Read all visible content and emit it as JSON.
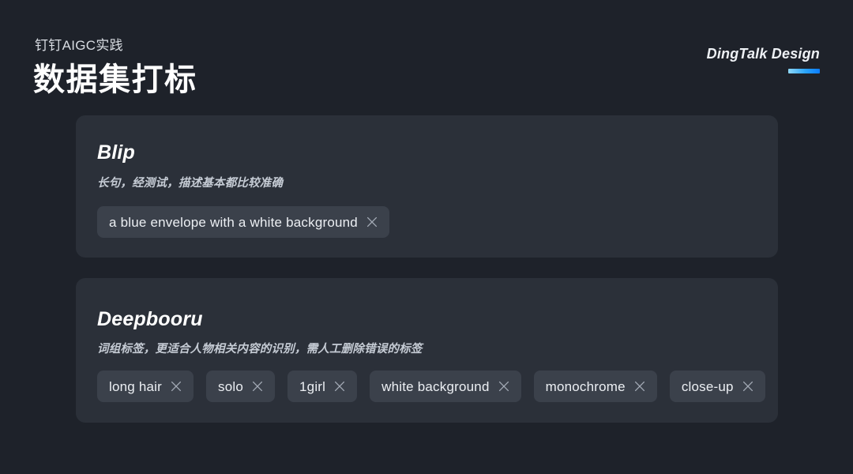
{
  "header": {
    "eyebrow": "钉钉AIGC实践",
    "title": "数据集打标",
    "brand": "DingTalk Design",
    "accent_gradient_from": "#8fd8f7",
    "accent_gradient_to": "#0a7cff"
  },
  "theme": {
    "page_background": "#1e222a",
    "card_background": "#2b3039",
    "chip_background": "#3b414b",
    "text_primary": "#ffffff",
    "text_secondary": "#c6ccd5",
    "chip_text": "#eceff3",
    "chip_close_icon": "#a4abb6"
  },
  "cards": [
    {
      "id": "blip",
      "title": "Blip",
      "subtitle": "长句，经测试，描述基本都比较准确",
      "tags": [
        {
          "label": "a blue envelope with a white background",
          "close_icon": "close-icon"
        }
      ]
    },
    {
      "id": "deepbooru",
      "title": "Deepbooru",
      "subtitle": "词组标签，更适合人物相关内容的识别，需人工删除错误的标签",
      "tags": [
        {
          "label": "long hair",
          "close_icon": "close-icon"
        },
        {
          "label": "solo",
          "close_icon": "close-icon"
        },
        {
          "label": "1girl",
          "close_icon": "close-icon"
        },
        {
          "label": "white background",
          "close_icon": "close-icon"
        },
        {
          "label": "monochrome",
          "close_icon": "close-icon"
        },
        {
          "label": "close-up",
          "close_icon": "close-icon"
        }
      ]
    }
  ]
}
